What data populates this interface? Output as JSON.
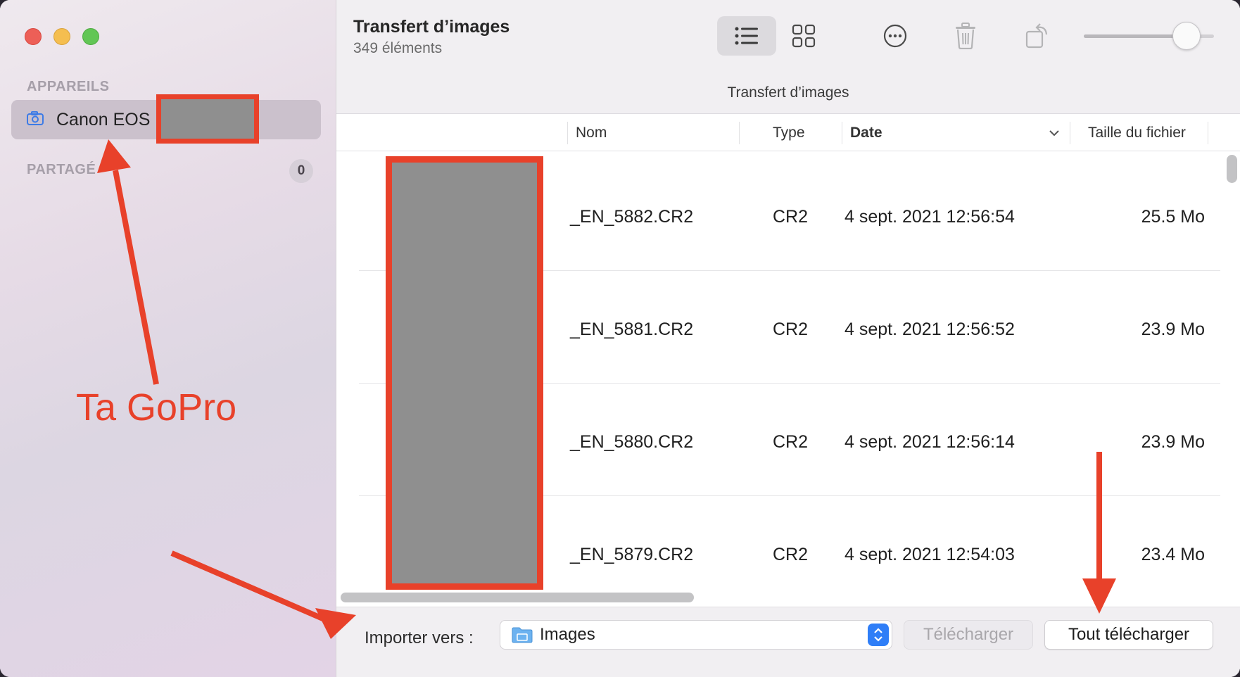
{
  "sidebar": {
    "section_devices": "APPAREILS",
    "device_name": "Canon EOS",
    "section_shared": "PARTAGÉ",
    "shared_count": "0"
  },
  "toolbar": {
    "title": "Transfert d’images",
    "subtitle": "349 éléments",
    "icons": [
      "list-view-icon",
      "grid-view-icon",
      "more-icon",
      "trash-icon",
      "rotate-icon"
    ],
    "zoom_fraction": 0.8
  },
  "path": {
    "label": "Transfert d’images"
  },
  "table": {
    "headers": {
      "name": "Nom",
      "type": "Type",
      "date": "Date",
      "size": "Taille du fichier"
    },
    "rows": [
      {
        "name": "_EN_5882.CR2",
        "type": "CR2",
        "date": "4 sept. 2021 12:56:54",
        "size": "25.5 Mo"
      },
      {
        "name": "_EN_5881.CR2",
        "type": "CR2",
        "date": "4 sept. 2021 12:56:52",
        "size": "23.9 Mo"
      },
      {
        "name": "_EN_5880.CR2",
        "type": "CR2",
        "date": "4 sept. 2021 12:56:14",
        "size": "23.9 Mo"
      },
      {
        "name": "_EN_5879.CR2",
        "type": "CR2",
        "date": "4 sept. 2021 12:54:03",
        "size": "23.4 Mo"
      }
    ]
  },
  "bottom": {
    "import_label": "Importer vers :",
    "destination": "Images",
    "download_label": "Télécharger",
    "download_all_label": "Tout télécharger"
  },
  "annotation": {
    "text": "Ta GoPro",
    "color": "#e8412a"
  }
}
